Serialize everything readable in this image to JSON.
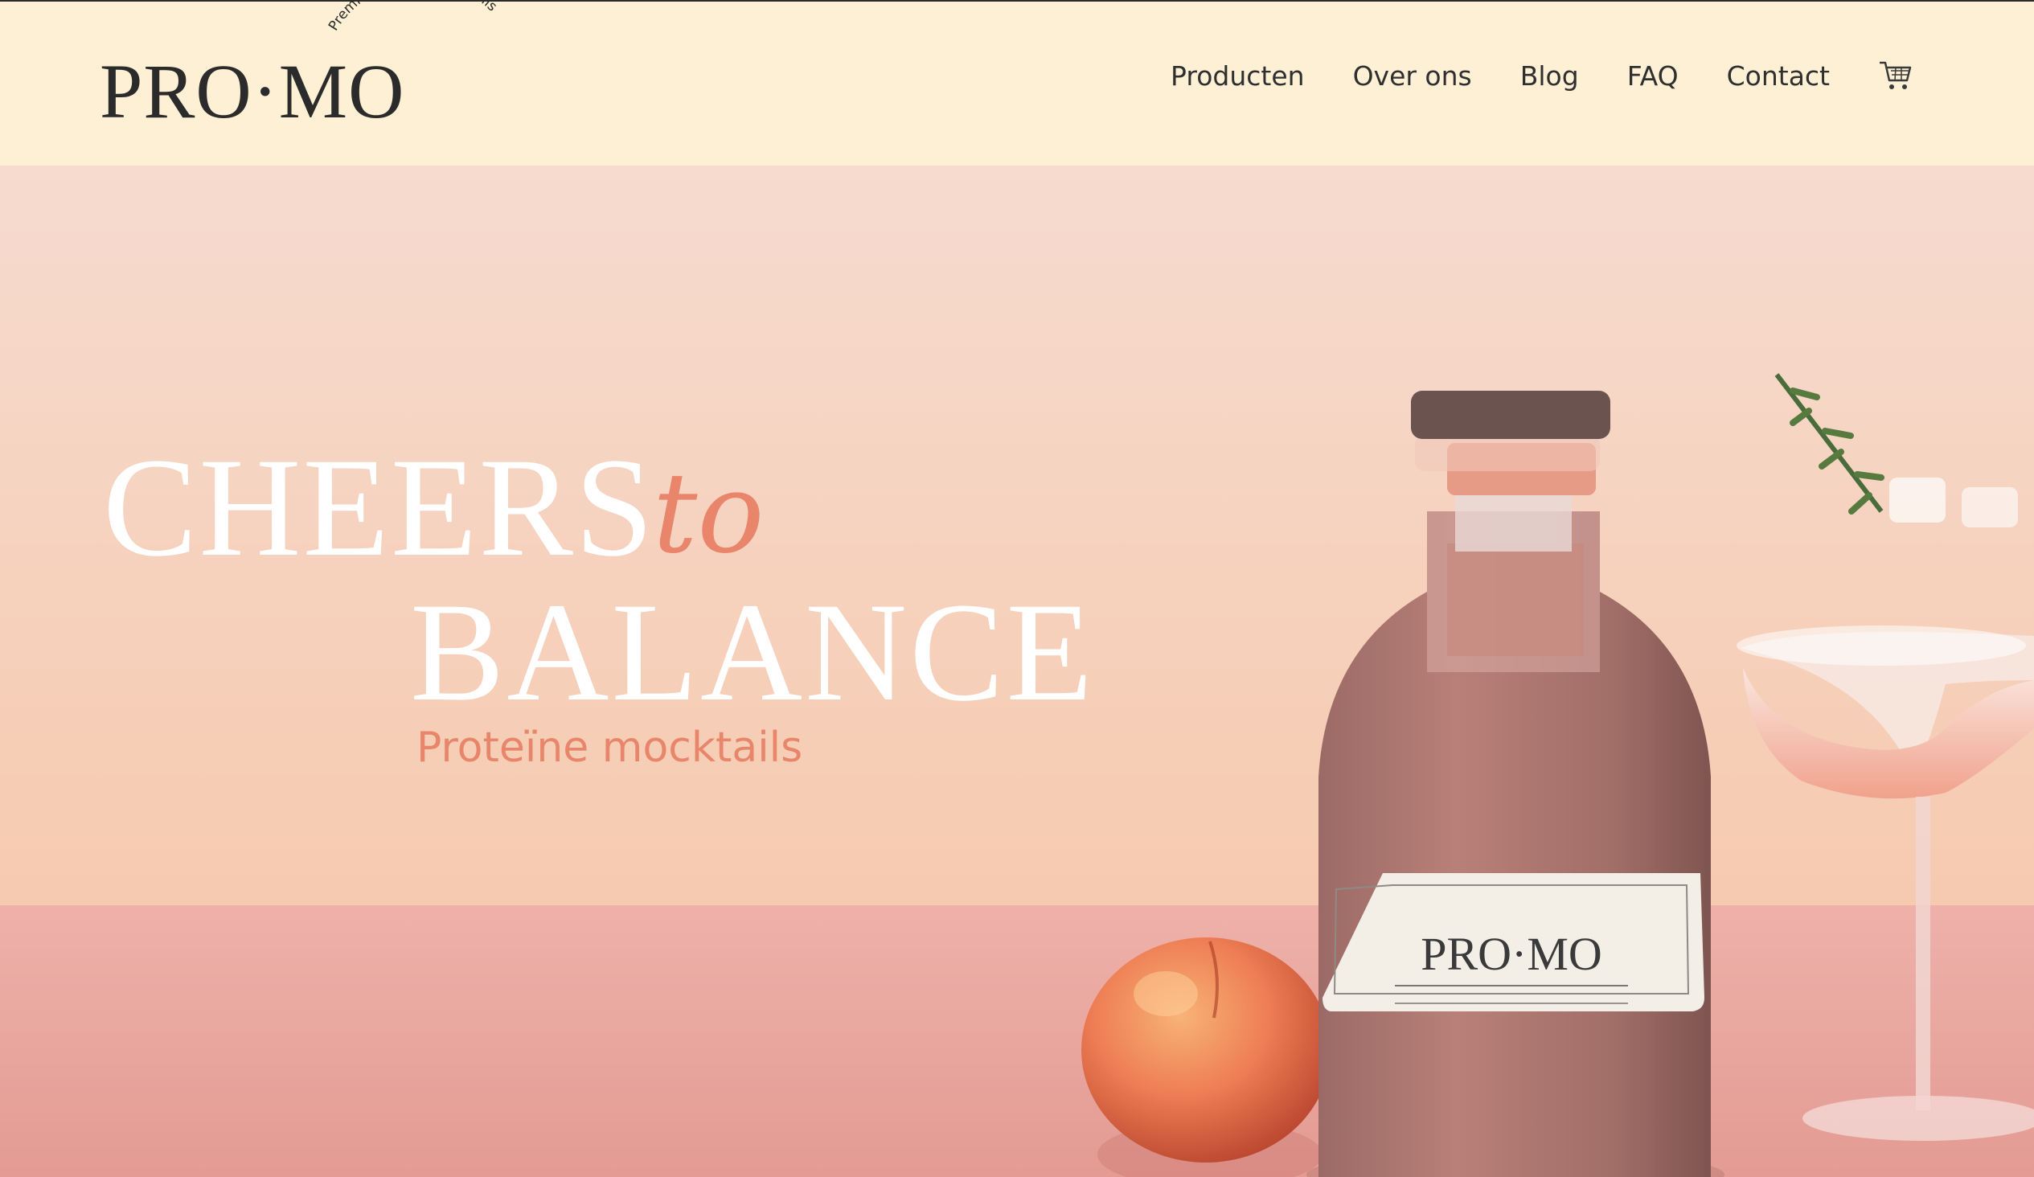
{
  "brand": {
    "name": "PRO·MO",
    "tagline": "Premium Protein Mocktails"
  },
  "nav": {
    "items": [
      "Producten",
      "Over ons",
      "Blog",
      "FAQ",
      "Contact"
    ],
    "cart_icon": "cart-icon"
  },
  "hero": {
    "headline_line1": "CHEERS",
    "headline_accent": "to",
    "headline_line2": "BALANCE",
    "subtitle": "Proteïne mocktails",
    "bottle_label_brand": "PRO·MO"
  },
  "colors": {
    "header_bg": "#fdf0d4",
    "accent": "#e8856a",
    "hero_wall": "#f5c9b4",
    "hero_table": "#e9a39c",
    "text_dark": "#2b2b2b"
  }
}
